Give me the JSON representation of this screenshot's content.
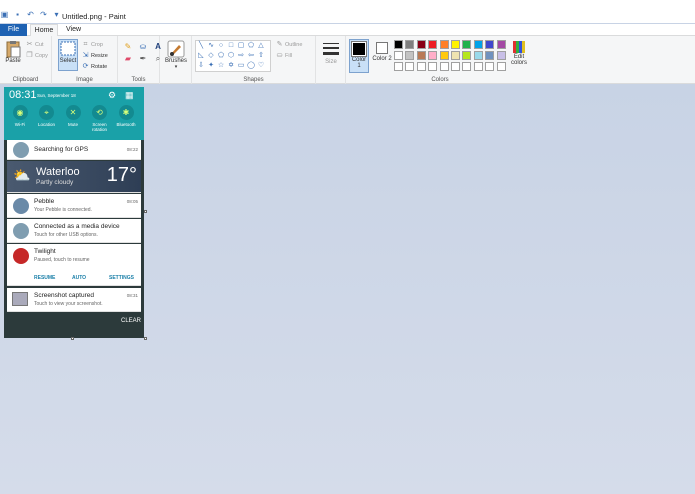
{
  "window": {
    "title": "Untitled.png - Paint"
  },
  "menu_tabs": {
    "file": "File",
    "home": "Home",
    "view": "View"
  },
  "ribbon": {
    "clipboard": {
      "label": "Clipboard",
      "paste": "Paste",
      "cut": "Cut",
      "copy": "Copy"
    },
    "image": {
      "label": "Image",
      "select": "Select",
      "crop": "Crop",
      "resize": "Resize",
      "rotate": "Rotate"
    },
    "tools": {
      "label": "Tools"
    },
    "brushes": {
      "label": "Brushes"
    },
    "shapes": {
      "label": "Shapes",
      "outline": "Outline",
      "fill": "Fill"
    },
    "size": {
      "label": "Size"
    },
    "colors": {
      "label": "Colors",
      "color1": "Color 1",
      "color2": "Color 2",
      "edit": "Edit colors",
      "palette_row1": [
        "#000000",
        "#7f7f7f",
        "#880015",
        "#ed1c24",
        "#ff7f27",
        "#fff200",
        "#22b14c",
        "#00a2e8",
        "#3f48cc",
        "#a349a4"
      ],
      "palette_row2": [
        "#ffffff",
        "#c3c3c3",
        "#b97a57",
        "#ffaec9",
        "#ffc90e",
        "#efe4b0",
        "#b5e61d",
        "#99d9ea",
        "#7092be",
        "#c8bfe7"
      ],
      "palette_row3": [
        "#ffffff",
        "#ffffff",
        "#ffffff",
        "#ffffff",
        "#ffffff",
        "#ffffff",
        "#ffffff",
        "#ffffff",
        "#ffffff",
        "#ffffff"
      ]
    }
  },
  "screenshot": {
    "time": "08:31",
    "date": "Sun, September 18",
    "toggles": [
      "Wi-Fi",
      "Location",
      "Mute",
      "Screen rotation",
      "Bluetooth"
    ],
    "notifications": {
      "gps": {
        "title": "Searching for GPS",
        "time": "08:22"
      },
      "weather": {
        "city": "Waterloo",
        "condition": "Partly cloudy",
        "temp": "17°"
      },
      "pebble": {
        "title": "Pebble",
        "sub": "Your Pebble is connected.",
        "time": "08:05"
      },
      "usb": {
        "title": "Connected as a media device",
        "sub": "Touch for other USB options."
      },
      "twilight": {
        "title": "Twilight",
        "sub": "Paused, touch to resume",
        "actions": [
          "RESUME",
          "AUTO",
          "SETTINGS"
        ]
      },
      "shot": {
        "title": "Screenshot captured",
        "sub": "Touch to view your screenshot.",
        "time": "08:31"
      }
    },
    "clear": "CLEAR"
  }
}
